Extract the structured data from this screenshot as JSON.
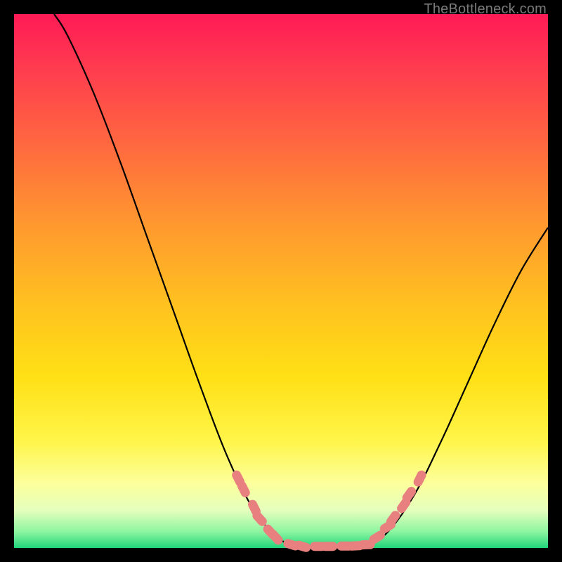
{
  "attribution_text": "TheBottleneck.com",
  "chart_data": {
    "type": "line",
    "title": "",
    "xlabel": "",
    "ylabel": "",
    "xlim": [
      0,
      100
    ],
    "ylim": [
      0,
      100
    ],
    "grid": false,
    "legend": false,
    "curve_points": [
      {
        "x": 7.5,
        "y": 100
      },
      {
        "x": 10,
        "y": 96
      },
      {
        "x": 15,
        "y": 85
      },
      {
        "x": 20,
        "y": 72
      },
      {
        "x": 25,
        "y": 58
      },
      {
        "x": 30,
        "y": 44
      },
      {
        "x": 35,
        "y": 30
      },
      {
        "x": 40,
        "y": 17
      },
      {
        "x": 45,
        "y": 7
      },
      {
        "x": 50,
        "y": 1.5
      },
      {
        "x": 54,
        "y": 0.3
      },
      {
        "x": 58,
        "y": 0.3
      },
      {
        "x": 62,
        "y": 0.3
      },
      {
        "x": 66,
        "y": 0.5
      },
      {
        "x": 70,
        "y": 3
      },
      {
        "x": 75,
        "y": 10
      },
      {
        "x": 80,
        "y": 20
      },
      {
        "x": 85,
        "y": 31
      },
      {
        "x": 90,
        "y": 42
      },
      {
        "x": 95,
        "y": 52
      },
      {
        "x": 100,
        "y": 60
      }
    ],
    "highlighted_points": [
      {
        "x": 42,
        "y": 13
      },
      {
        "x": 43,
        "y": 11
      },
      {
        "x": 45,
        "y": 7.5
      },
      {
        "x": 46,
        "y": 5.5
      },
      {
        "x": 48,
        "y": 3
      },
      {
        "x": 49,
        "y": 2
      },
      {
        "x": 52,
        "y": 0.6
      },
      {
        "x": 54,
        "y": 0.3
      },
      {
        "x": 57,
        "y": 0.3
      },
      {
        "x": 59,
        "y": 0.3
      },
      {
        "x": 62,
        "y": 0.35
      },
      {
        "x": 64,
        "y": 0.4
      },
      {
        "x": 66,
        "y": 0.6
      },
      {
        "x": 68,
        "y": 2
      },
      {
        "x": 70,
        "y": 4
      },
      {
        "x": 71,
        "y": 5.5
      },
      {
        "x": 73,
        "y": 8
      },
      {
        "x": 74,
        "y": 10
      },
      {
        "x": 76,
        "y": 13
      }
    ],
    "gradient_stops": [
      {
        "pos": 0.0,
        "color": "#ff1a55"
      },
      {
        "pos": 0.4,
        "color": "#ff9a2e"
      },
      {
        "pos": 0.7,
        "color": "#ffe015"
      },
      {
        "pos": 0.9,
        "color": "#fcff9c"
      },
      {
        "pos": 1.0,
        "color": "#21d47a"
      }
    ]
  }
}
